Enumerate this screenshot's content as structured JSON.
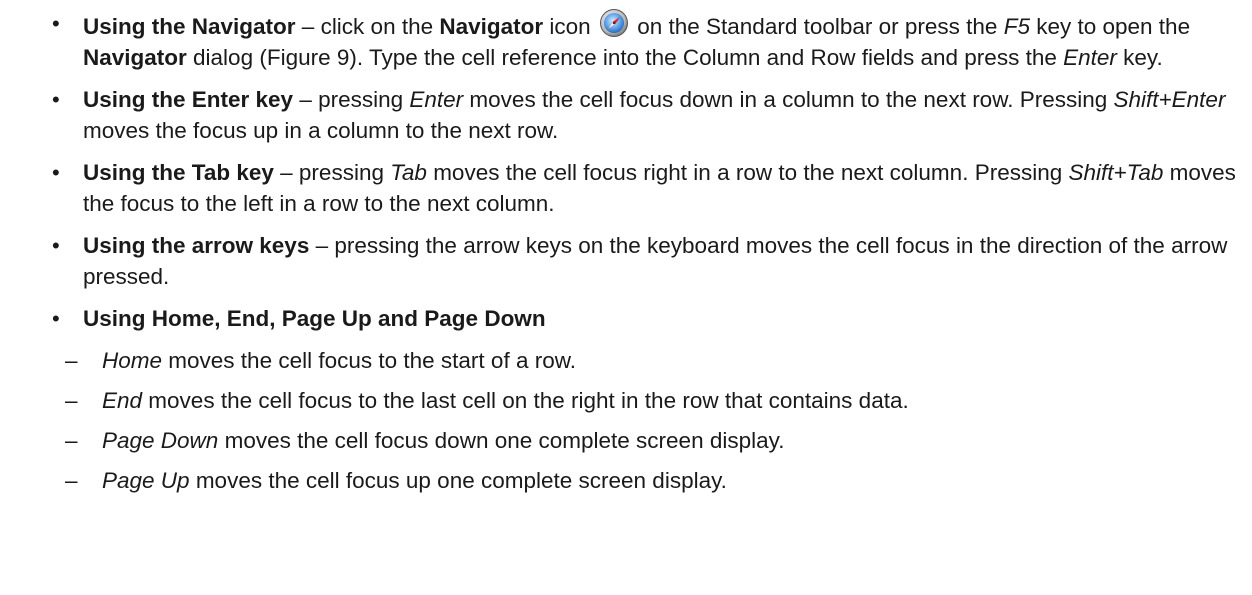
{
  "bullet_symbol": "•",
  "dash_symbol": "–",
  "items": [
    {
      "title": "Using the Navigator",
      "sep": " – ",
      "t1": "click on the ",
      "b1": "Navigator",
      "t2": " icon",
      "icon": "navigator-compass-icon",
      "t3": " on the Standard toolbar or press the ",
      "i1": "F5",
      "t4": " key to open the ",
      "b2": "Navigator",
      "t5": " dialog (Figure 9). Type the cell reference into the Column and Row fields and press the ",
      "i2": "Enter",
      "t6": " key."
    },
    {
      "title": "Using the Enter key",
      "sep": " – ",
      "t1": "pressing ",
      "i1": "Enter",
      "t2": " moves the cell focus down in a column to the next row. Pressing ",
      "i2": "Shift+Enter",
      "t3": " moves the focus up in a column to the next row."
    },
    {
      "title": "Using the Tab key",
      "sep": " – ",
      "t1": "pressing ",
      "i1": "Tab",
      "t2": " moves the cell focus right in a row to the next column. Pressing ",
      "i2": "Shift+Tab",
      "t3": " moves the focus to the left in a row to the next column."
    },
    {
      "title": "Using the arrow keys",
      "sep": " – ",
      "t1": "pressing the arrow keys on the keyboard moves the cell focus in the direction of the arrow pressed."
    },
    {
      "title": "Using Home, End, Page Up and Page Down",
      "sub": [
        {
          "key": "Home",
          "text": " moves the cell focus to the start of a row."
        },
        {
          "key": "End",
          "text": " moves the cell focus to the last cell on the right in the row that contains data."
        },
        {
          "key": "Page Down",
          "text": " moves the cell focus down one complete screen display."
        },
        {
          "key": "Page Up",
          "text": " moves the cell focus up one complete screen display."
        }
      ]
    }
  ]
}
